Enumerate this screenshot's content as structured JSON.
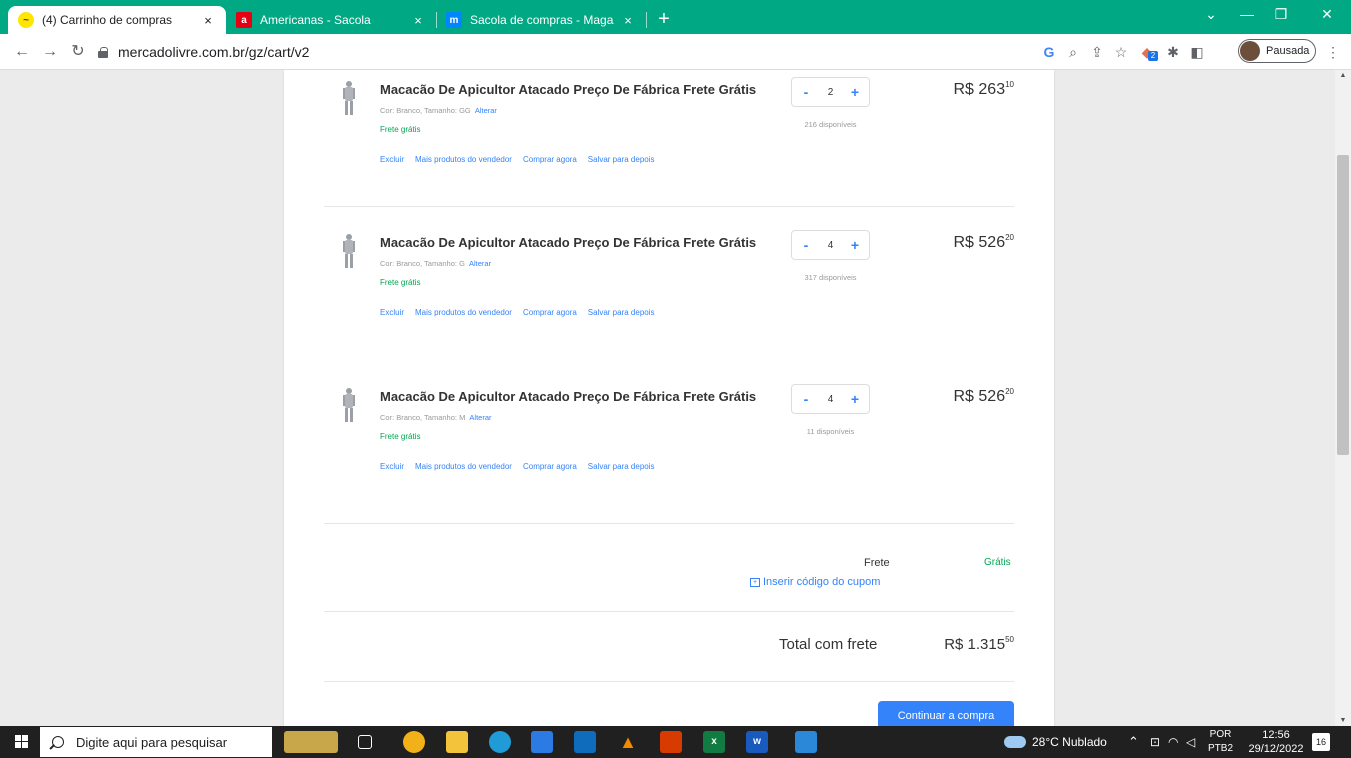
{
  "browser": {
    "tabs": [
      {
        "title": "(4) Carrinho de compras",
        "favicon": "mercadolivre-handshake-icon",
        "active": true
      },
      {
        "title": "Americanas - Sacola",
        "favicon": "americanas-icon",
        "active": false
      },
      {
        "title": "Sacola de compras - Magazine Lu",
        "favicon": "magalu-icon",
        "active": false
      }
    ],
    "close_symbol": "×",
    "new_tab_symbol": "+",
    "url": "mercadolivre.com.br/gz/cart/v2",
    "profile_label": "Pausada",
    "extension_badge": "2"
  },
  "cart": {
    "items": [
      {
        "title": "Macacão De Apicultor Atacado Preço De Fábrica Frete Grátis",
        "variant": "Cor: Branco, Tamanho: GG",
        "change_link": "Alterar",
        "shipping": "Frete grátis",
        "actions": [
          "Excluir",
          "Mais produtos do vendedor",
          "Comprar agora",
          "Salvar para depois"
        ],
        "qty_minus": "-",
        "quantity": "2",
        "qty_plus": "+",
        "stock": "216 disponíveis",
        "price_main": "R$ 263",
        "price_cents": "10"
      },
      {
        "title": "Macacão De Apicultor Atacado Preço De Fábrica Frete Grátis",
        "variant": "Cor: Branco, Tamanho: G",
        "change_link": "Alterar",
        "shipping": "Frete grátis",
        "actions": [
          "Excluir",
          "Mais produtos do vendedor",
          "Comprar agora",
          "Salvar para depois"
        ],
        "qty_minus": "-",
        "quantity": "4",
        "qty_plus": "+",
        "stock": "317 disponíveis",
        "price_main": "R$ 526",
        "price_cents": "20"
      },
      {
        "title": "Macacão De Apicultor Atacado Preço De Fábrica Frete Grátis",
        "variant": "Cor: Branco, Tamanho: M",
        "change_link": "Alterar",
        "shipping": "Frete grátis",
        "actions": [
          "Excluir",
          "Mais produtos do vendedor",
          "Comprar agora",
          "Salvar para depois"
        ],
        "qty_minus": "-",
        "quantity": "4",
        "qty_plus": "+",
        "stock": "11 disponíveis",
        "price_main": "R$ 526",
        "price_cents": "20"
      }
    ],
    "shipping_label": "Frete",
    "shipping_value": "Grátis",
    "coupon_link": "Inserir código do cupom",
    "total_label": "Total com frete",
    "total_main": "R$ 1.315",
    "total_cents": "50",
    "continue_button": "Continuar a compra"
  },
  "taskbar": {
    "search_placeholder": "Digite aqui para pesquisar",
    "weather": "28°C  Nublado",
    "lang_top": "POR",
    "lang_bottom": "PTB2",
    "time": "12:56",
    "date": "29/12/2022",
    "notifications": "16"
  },
  "colors": {
    "tabstrip": "#00a884",
    "link": "#3483fa",
    "green": "#00a650",
    "button": "#3483fa"
  }
}
